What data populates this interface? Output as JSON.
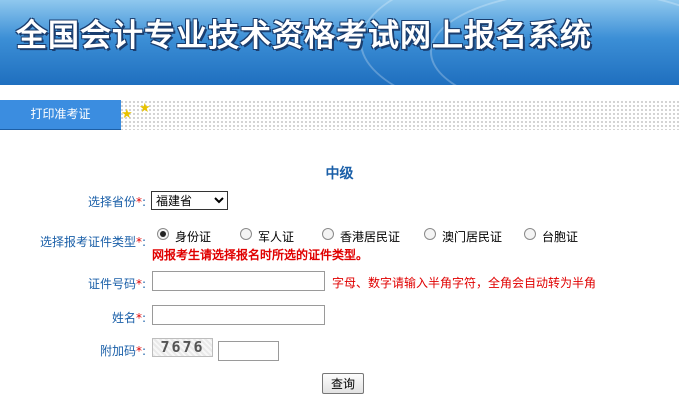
{
  "header": {
    "title": "全国会计专业技术资格考试网上报名系统"
  },
  "tab": {
    "label": "打印准考证"
  },
  "form": {
    "level": "中级",
    "province": {
      "label": "选择省份",
      "required_mark": "*",
      "suffix": ":",
      "value": "福建省"
    },
    "id_type": {
      "label": "选择报考证件类型",
      "required_mark": "*",
      "suffix": ":",
      "options": [
        "身份证",
        "军人证",
        "香港居民证",
        "澳门居民证",
        "台胞证"
      ],
      "selected": "身份证",
      "warning": "网报考生请选择报名时所选的证件类型。"
    },
    "id_number": {
      "label": "证件号码",
      "required_mark": "*",
      "suffix": ":",
      "value": "",
      "hint": "字母、数字请输入半角字符，全角会自动转为半角"
    },
    "name": {
      "label": "姓名",
      "required_mark": "*",
      "suffix": ":",
      "value": ""
    },
    "captcha": {
      "label": "附加码",
      "required_mark": "*",
      "suffix": ":",
      "image_text": "7676",
      "value": ""
    },
    "submit_label": "查询"
  },
  "colors": {
    "label": "#1a5fa8",
    "required": "#e00000",
    "tab": "#3b8de0",
    "banner": "#2f7fcf"
  }
}
